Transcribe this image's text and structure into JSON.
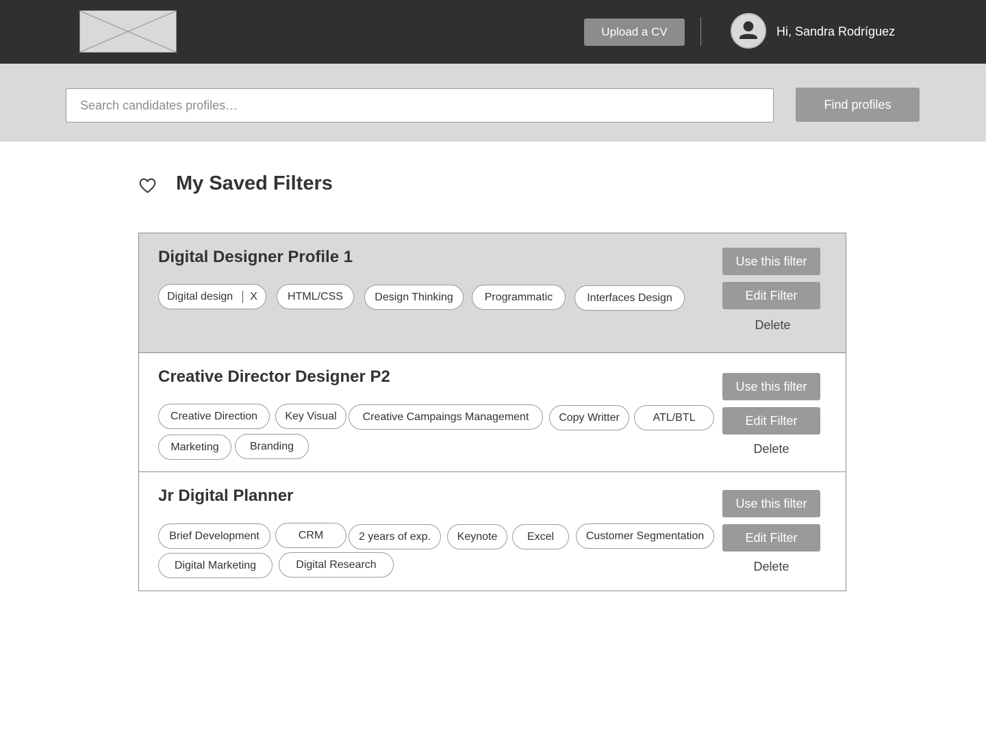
{
  "header": {
    "logo_icon": "image-placeholder-icon",
    "upload_label": "Upload a CV",
    "avatar_icon": "user-icon",
    "greeting": "Hi, Sandra Rodríguez"
  },
  "search": {
    "placeholder": "Search candidates profiles…",
    "value": "",
    "button_label": "Find profiles"
  },
  "page": {
    "title_icon": "heart-icon",
    "title": "My Saved Filters"
  },
  "filters": [
    {
      "title": "Digital Designer Profile 1",
      "selected": true,
      "tags": [
        "Digital design",
        "HTML/CSS",
        "Design Thinking",
        "Programmatic",
        "Interfaces Design"
      ],
      "tag_remove_label": "X",
      "use_label": "Use this filter",
      "edit_label": "Edit Filter",
      "delete_label": "Delete"
    },
    {
      "title": "Creative Director Designer P2",
      "selected": false,
      "tags": [
        "Creative Direction",
        "Key Visual",
        "Creative Campaings Management",
        "Copy Writter",
        "ATL/BTL",
        "Marketing",
        "Branding"
      ],
      "use_label": "Use this filter",
      "edit_label": "Edit Filter",
      "delete_label": "Delete"
    },
    {
      "title": "Jr Digital Planner",
      "selected": false,
      "tags": [
        "Brief Development",
        "CRM",
        "2 years of exp.",
        "Keynote",
        "Excel",
        "Customer Segmentation",
        "Digital Marketing",
        "Digital Research"
      ],
      "use_label": "Use this filter",
      "edit_label": "Edit Filter",
      "delete_label": "Delete"
    }
  ],
  "colors": {
    "header_bg": "#303030",
    "search_band_bg": "#d9d9d9",
    "button_bg": "#9a9a9a",
    "selected_card_bg": "#d9d9d9"
  }
}
